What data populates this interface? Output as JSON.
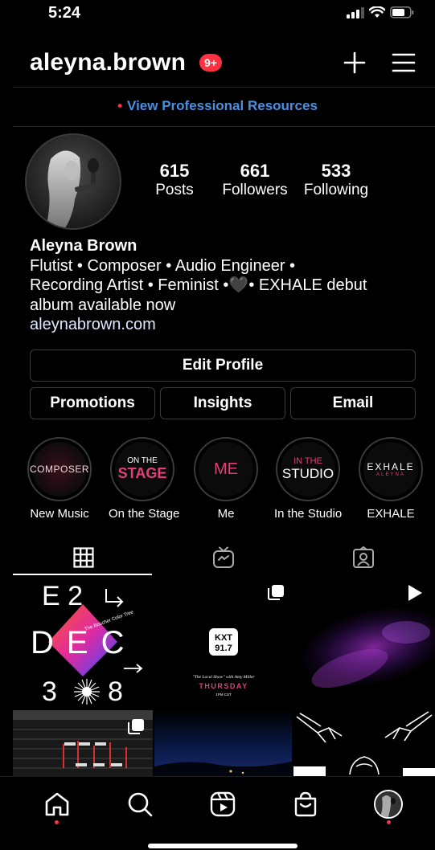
{
  "status_bar": {
    "time": "5:24"
  },
  "header": {
    "username": "aleyna.brown",
    "notification_badge": "9+"
  },
  "pro_banner": {
    "dot": "•",
    "label": "View Professional Resources"
  },
  "stats": [
    {
      "value": "615",
      "label": "Posts"
    },
    {
      "value": "661",
      "label": "Followers"
    },
    {
      "value": "533",
      "label": "Following"
    }
  ],
  "bio": {
    "name": "Aleyna Brown",
    "line1": "Flutist • Composer • Audio Engineer •",
    "line2": "Recording Artist • Feminist •🖤• EXHALE debut",
    "line3": "album available now",
    "link": "aleynabrown.com"
  },
  "buttons": {
    "edit_profile": "Edit Profile",
    "promotions": "Promotions",
    "insights": "Insights",
    "email": "Email"
  },
  "highlights": [
    {
      "cover_line1": "COMPOSER",
      "cover_line2": "",
      "label": "New Music"
    },
    {
      "cover_line1": "ON THE",
      "cover_line2": "STAGE",
      "label": "On the Stage"
    },
    {
      "cover_line1": "ME",
      "cover_line2": "",
      "label": "Me"
    },
    {
      "cover_line1": "IN THE",
      "cover_line2": "STUDIO",
      "label": "In the Studio"
    },
    {
      "cover_line1": "EXHALE",
      "cover_line2": "ALEYNA",
      "label": "EXHALE"
    }
  ],
  "tabs": [
    {
      "icon": "grid-icon",
      "active": true
    },
    {
      "icon": "igtv-icon",
      "active": false
    },
    {
      "icon": "tagged-icon",
      "active": false
    }
  ],
  "posts": {
    "post1": {
      "top_row": "E 2",
      "middle": "DEC",
      "bottom_row": "3",
      "bottom_right": "8",
      "caption": "The Boucher Color Tree"
    },
    "post2": {
      "logo_line1": "KXT",
      "logo_line2": "91.7",
      "show": "\"The Local Show\" with Amy Miller",
      "day": "THURSDAY",
      "time": "1PM CST"
    }
  },
  "colors": {
    "accent_link": "#4a8fe0",
    "badge_red": "#ff3040",
    "highlight_pink": "#e0407a"
  }
}
